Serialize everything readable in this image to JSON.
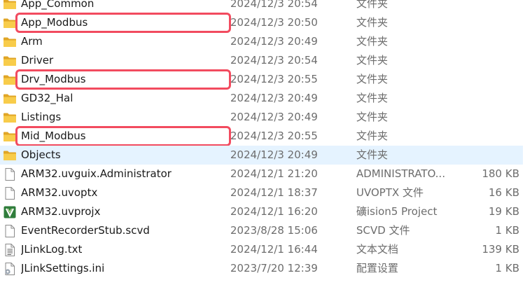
{
  "files": [
    {
      "name": "App_Common",
      "date": "2024/12/3 20:54",
      "type": "文件夹",
      "size": "",
      "icon": "folder-icon",
      "highlighted": false,
      "selected": false
    },
    {
      "name": "App_Modbus",
      "date": "2024/12/3 20:50",
      "type": "文件夹",
      "size": "",
      "icon": "folder-icon",
      "highlighted": true,
      "selected": false
    },
    {
      "name": "Arm",
      "date": "2024/12/3 20:49",
      "type": "文件夹",
      "size": "",
      "icon": "folder-icon",
      "highlighted": false,
      "selected": false
    },
    {
      "name": "Driver",
      "date": "2024/12/3 20:54",
      "type": "文件夹",
      "size": "",
      "icon": "folder-icon",
      "highlighted": false,
      "selected": false
    },
    {
      "name": "Drv_Modbus",
      "date": "2024/12/3 20:55",
      "type": "文件夹",
      "size": "",
      "icon": "folder-icon",
      "highlighted": true,
      "selected": false
    },
    {
      "name": "GD32_Hal",
      "date": "2024/12/3 20:49",
      "type": "文件夹",
      "size": "",
      "icon": "folder-icon",
      "highlighted": false,
      "selected": false
    },
    {
      "name": "Listings",
      "date": "2024/12/3 20:49",
      "type": "文件夹",
      "size": "",
      "icon": "folder-icon",
      "highlighted": false,
      "selected": false
    },
    {
      "name": "Mid_Modbus",
      "date": "2024/12/3 20:55",
      "type": "文件夹",
      "size": "",
      "icon": "folder-icon",
      "highlighted": true,
      "selected": false
    },
    {
      "name": "Objects",
      "date": "2024/12/3 20:49",
      "type": "文件夹",
      "size": "",
      "icon": "folder-icon",
      "highlighted": false,
      "selected": true
    },
    {
      "name": "ARM32.uvguix.Administrator",
      "date": "2024/12/1 21:20",
      "type": "ADMINISTRATO...",
      "size": "180 KB",
      "icon": "file-icon",
      "highlighted": false,
      "selected": false
    },
    {
      "name": "ARM32.uvoptx",
      "date": "2024/12/1 18:37",
      "type": "UVOPTX 文件",
      "size": "16 KB",
      "icon": "file-icon",
      "highlighted": false,
      "selected": false
    },
    {
      "name": "ARM32.uvprojx",
      "date": "2024/12/1 16:20",
      "type": "礦ision5 Project",
      "size": "19 KB",
      "icon": "keil-project-icon",
      "highlighted": false,
      "selected": false
    },
    {
      "name": "EventRecorderStub.scvd",
      "date": "2023/8/28 15:06",
      "type": "SCVD 文件",
      "size": "1 KB",
      "icon": "file-icon",
      "highlighted": false,
      "selected": false
    },
    {
      "name": "JLinkLog.txt",
      "date": "2024/12/1 16:44",
      "type": "文本文档",
      "size": "139 KB",
      "icon": "text-file-icon",
      "highlighted": false,
      "selected": false
    },
    {
      "name": "JLinkSettings.ini",
      "date": "2023/7/20 12:39",
      "type": "配置设置",
      "size": "1 KB",
      "icon": "settings-file-icon",
      "highlighted": false,
      "selected": false
    }
  ]
}
